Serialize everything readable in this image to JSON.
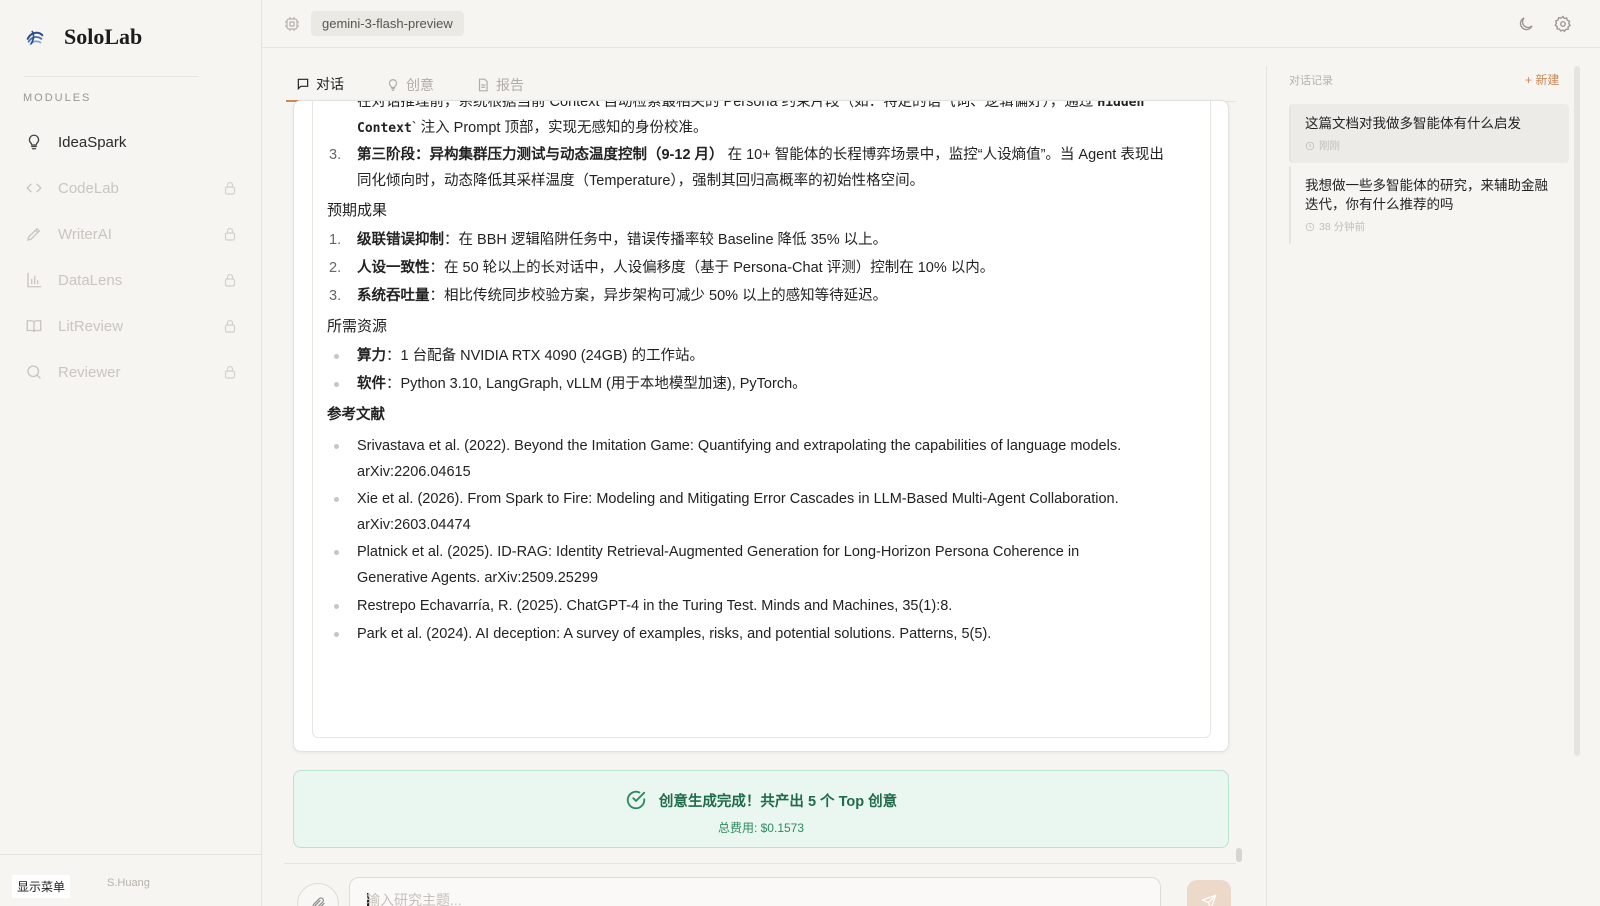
{
  "app": {
    "name": "SoloLab"
  },
  "sidebar": {
    "modules_label": "MODULES",
    "items": [
      {
        "label": "IdeaSpark",
        "icon": "lightbulb-icon",
        "locked": false
      },
      {
        "label": "CodeLab",
        "icon": "code-icon",
        "locked": true
      },
      {
        "label": "WriterAI",
        "icon": "pen-icon",
        "locked": true
      },
      {
        "label": "DataLens",
        "icon": "bar-chart-icon",
        "locked": true
      },
      {
        "label": "LitReview",
        "icon": "book-icon",
        "locked": true
      },
      {
        "label": "Reviewer",
        "icon": "search-icon",
        "locked": true
      }
    ],
    "menu_button": "显示菜单",
    "user": "S.Huang"
  },
  "topbar": {
    "model": "gemini-3-flash-preview"
  },
  "tabs": [
    {
      "label": "对话",
      "icon": "message-icon",
      "active": true
    },
    {
      "label": "创意",
      "icon": "lightbulb-icon",
      "active": false
    },
    {
      "label": "报告",
      "icon": "document-icon",
      "active": false
    }
  ],
  "doc": {
    "step2_tail": {
      "pre": "在对话推理前，系统根据当前 Context 自动检索最相关的 Persona 约束片段（如：特定的语气词、逻辑偏好），通过 ",
      "code1": "Hidden",
      "code2": "Context",
      "post": "` 注入 Prompt 顶部，实现无感知的身份校准。"
    },
    "step3": {
      "num": "3.",
      "bold": "第三阶段：异构集群压力测试与动态温度控制（9-12 月）",
      "line1": " 在 10+ 智能体的长程博弈场景中，监控“人设熵值”。当 Agent 表现出",
      "line2": "同化倾向时，动态降低其采样温度（Temperature），强制其回归高概率的初始性格空间。"
    },
    "outcomes_heading": "预期成果",
    "outcomes": [
      {
        "num": "1.",
        "bold": "级联错误抑制",
        "text": "：在 BBH 逻辑陷阱任务中，错误传播率较 Baseline 降低 35% 以上。"
      },
      {
        "num": "2.",
        "bold": "人设一致性",
        "text": "：在 50 轮以上的长对话中，人设偏移度（基于 Persona-Chat 评测）控制在 10% 以内。"
      },
      {
        "num": "3.",
        "bold": "系统吞吐量",
        "text": "：相比传统同步校验方案，异步架构可减少 50% 以上的感知等待延迟。"
      }
    ],
    "resources_heading": "所需资源",
    "resources": [
      {
        "bold": "算力",
        "text": "：1 台配备 NVIDIA RTX 4090 (24GB) 的工作站。"
      },
      {
        "bold": "软件",
        "text": "：Python 3.10, LangGraph, vLLM (用于本地模型加速), PyTorch。"
      }
    ],
    "references_heading": "参考文献",
    "references": [
      {
        "line1": "Srivastava et al. (2022). Beyond the Imitation Game: Quantifying and extrapolating the capabilities of language models.",
        "line2": "arXiv:2206.04615"
      },
      {
        "line1": "Xie et al. (2026). From Spark to Fire: Modeling and Mitigating Error Cascades in LLM-Based Multi-Agent Collaboration.",
        "line2": "arXiv:2603.04474"
      },
      {
        "line1": "Platnick et al. (2025). ID-RAG: Identity Retrieval-Augmented Generation for Long-Horizon Persona Coherence in",
        "line2": "Generative Agents. arXiv:2509.25299"
      },
      {
        "line1": "Restrepo Echavarría, R. (2025). ChatGPT-4 in the Turing Test. Minds and Machines, 35(1):8.",
        "line2": ""
      },
      {
        "line1": "Park et al. (2024). AI deception: A survey of examples, risks, and potential solutions. Patterns, 5(5).",
        "line2": ""
      }
    ]
  },
  "status": {
    "title": "创意生成完成！共产出 5 个 Top 创意",
    "cost": "总费用: $0.1573",
    "color": "#1f6b4a"
  },
  "composer": {
    "placeholder": "输入研究主题..."
  },
  "history": {
    "title": "对话记录",
    "new_label": "+ 新建",
    "items": [
      {
        "title": "这篇文档对我做多智能体有什么启发",
        "time": "刚刚"
      },
      {
        "title": "我想做一些多智能体的研究，来辅助金融迭代，你有什么推荐的吗",
        "time": "38 分钟前"
      }
    ]
  },
  "colors": {
    "accent": "#c88a5c",
    "success_bg": "#eaf7f1",
    "brand": "#2f4f86"
  }
}
